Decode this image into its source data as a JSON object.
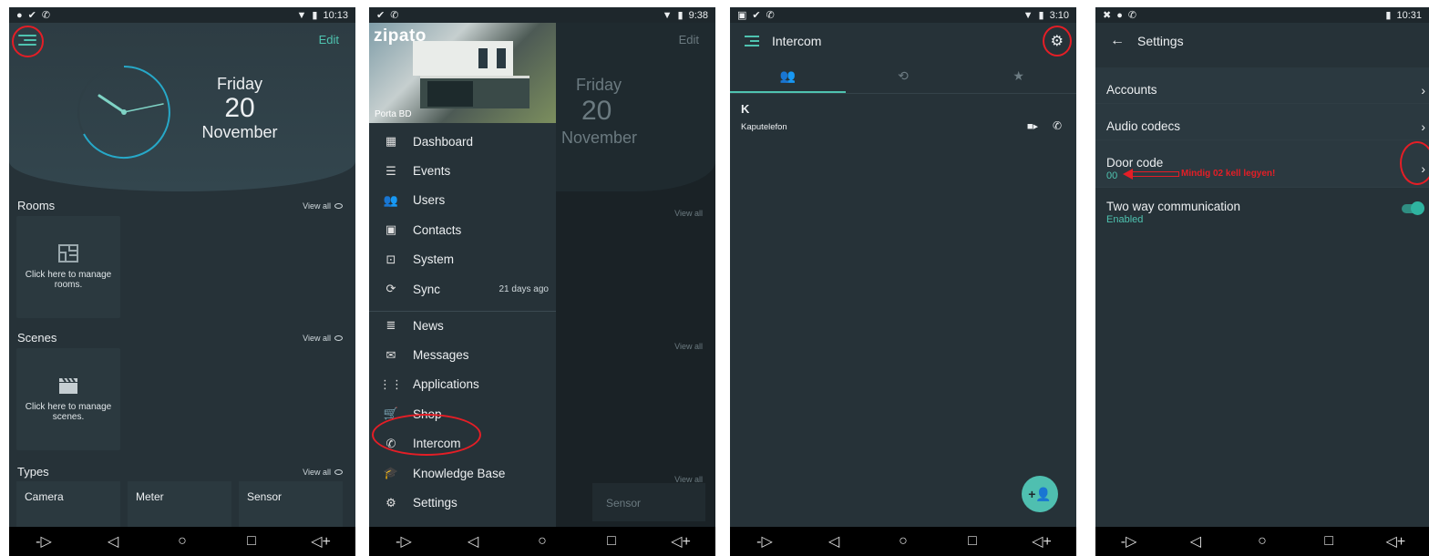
{
  "nav": {
    "back": "◁",
    "home": "○",
    "recents": "□",
    "vol_down": "-▷",
    "vol_up": "◁+"
  },
  "panel1": {
    "time": "10:13",
    "edit": "Edit",
    "date": {
      "weekday": "Friday",
      "day": "20",
      "month": "November"
    },
    "rooms": {
      "title": "Rooms",
      "view_all": "View all",
      "card_text": "Click here to manage rooms."
    },
    "scenes": {
      "title": "Scenes",
      "view_all": "View all",
      "card_text": "Click here to manage scenes."
    },
    "types": {
      "title": "Types",
      "view_all": "View all",
      "items": [
        "Camera",
        "Meter",
        "Sensor"
      ]
    }
  },
  "panel2": {
    "time": "9:38",
    "brand": "zipato",
    "location": "Porta BD",
    "menu": [
      {
        "label": "Dashboard",
        "icon": "dashboard-icon"
      },
      {
        "label": "Events",
        "icon": "list-icon"
      },
      {
        "label": "Users",
        "icon": "users-icon"
      },
      {
        "label": "Contacts",
        "icon": "contacts-icon"
      },
      {
        "label": "System",
        "icon": "system-icon"
      },
      {
        "label": "Sync",
        "icon": "sync-icon",
        "meta": "21 days ago"
      }
    ],
    "menu2": [
      {
        "label": "News",
        "icon": "news-icon"
      },
      {
        "label": "Messages",
        "icon": "mail-icon"
      },
      {
        "label": "Applications",
        "icon": "apps-icon"
      },
      {
        "label": "Shop",
        "icon": "cart-icon"
      },
      {
        "label": "Intercom",
        "icon": "phone-icon"
      },
      {
        "label": "Knowledge Base",
        "icon": "school-icon"
      },
      {
        "label": "Settings",
        "icon": "gear-icon"
      }
    ],
    "ghost": {
      "edit": "Edit",
      "weekday": "Friday",
      "day": "20",
      "month": "November",
      "view_all": "View all",
      "sensor": "Sensor"
    }
  },
  "panel3": {
    "time": "3:10",
    "title": "Intercom",
    "section_letter": "K",
    "contact": "Kaputelefon"
  },
  "panel4": {
    "time": "10:31",
    "title": "Settings",
    "rows": [
      {
        "title": "Accounts"
      },
      {
        "title": "Audio codecs"
      },
      {
        "title": "Door code",
        "sub": "00"
      },
      {
        "title": "Two way communication",
        "sub": "Enabled"
      }
    ],
    "annotation": "Mindig 02 kell legyen!"
  },
  "colors": {
    "accent": "#4fc3b0",
    "background": "#263238",
    "annotation_red": "#e41e26"
  }
}
